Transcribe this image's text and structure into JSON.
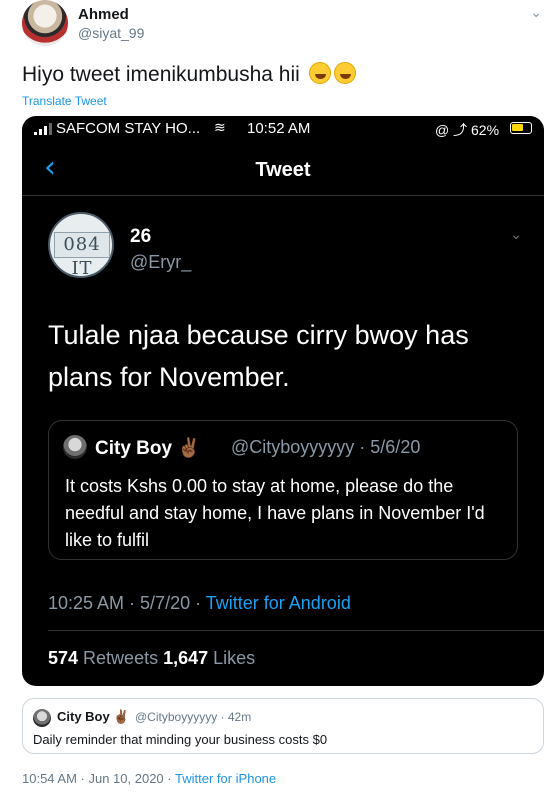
{
  "outer_tweet": {
    "author_name": "Ahmed",
    "author_handle": "@siyat_99",
    "text": "Hiyo tweet imenikumbusha hii",
    "emoji": "😂😂",
    "translate": "Translate Tweet",
    "caret_icon": "chevron-down-icon",
    "timestamp": "10:54 AM · Jun 10, 2020 · ",
    "source": "Twitter for iPhone"
  },
  "phone_screenshot": {
    "status_bar": {
      "carrier": "SAFCOM STAY HO...",
      "time": "10:52 AM",
      "icons": "@ ⤴ 62%",
      "battery_level": 0.62,
      "battery_color": "#ffd60a"
    },
    "nav": {
      "back_icon": "‹",
      "title": "Tweet"
    },
    "tweet": {
      "author_name": "26",
      "author_handle": "@Eryr_",
      "avatar_plate_text": "084 IT",
      "text": "Tulale njaa because cirry bwoy has plans for November.",
      "timestamp": "10:25 AM · 5/7/20 · ",
      "source": "Twitter for Android",
      "retweets_count": "574",
      "retweets_label": " Retweets ",
      "likes_count": "1,647",
      "likes_label": " Likes"
    },
    "quoted": {
      "author_name": "City Boy ✌🏾",
      "meta": "@Cityboyyyyyy · 5/6/20",
      "text": "It costs Kshs 0.00 to stay at home, please do the needful and stay home, I have plans in November I'd like to fulfil"
    }
  },
  "bottom_quote": {
    "author_name": "City Boy ✌🏾",
    "meta": "@Cityboyyyyyy · 42m",
    "text": "Daily reminder that minding your business costs $0"
  },
  "colors": {
    "link_blue": "#1b95e0",
    "dark_bg": "#000000",
    "muted": "#657786"
  }
}
